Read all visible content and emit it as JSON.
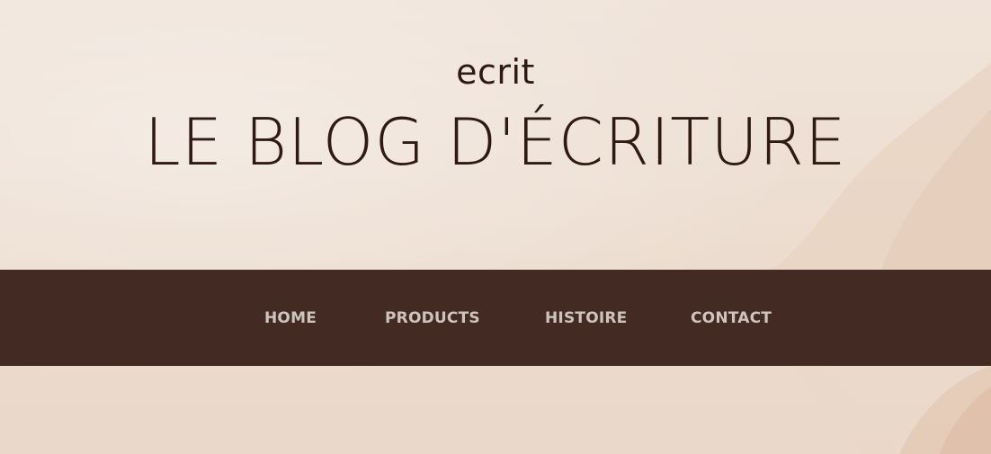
{
  "site": {
    "name": "ecrit",
    "title": "LE BLOG D'ÉCRITURE"
  },
  "nav": {
    "items": [
      {
        "label": "HOME"
      },
      {
        "label": "PRODUCTS"
      },
      {
        "label": "HISTOIRE"
      },
      {
        "label": "CONTACT"
      }
    ]
  },
  "colors": {
    "background": "#efe1d6",
    "text": "#2e1a12",
    "navbar": "#432a22",
    "nav_text": "#cfc4bd"
  }
}
